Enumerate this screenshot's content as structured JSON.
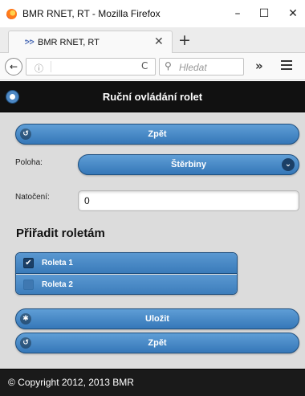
{
  "window": {
    "title": "BMR RNET, RT - Mozilla Firefox",
    "minimize": "–",
    "maximize": "☐",
    "close": "✕"
  },
  "tab": {
    "title": "BMR RNET, RT",
    "favicon": "ᕗᕗ",
    "close": "✕",
    "new_tab": "+"
  },
  "nav": {
    "back": "←",
    "info": "ⓘ",
    "reload": "C",
    "search_icon": "⚲",
    "search_placeholder": "Hledat",
    "overflow": "»"
  },
  "page": {
    "header_title": "Ruční ovládání rolet",
    "back_top_label": "Zpět",
    "poloha_label": "Poloha:",
    "poloha_value": "Štěrbiny",
    "natoceni_label": "Natočení:",
    "natoceni_value": "0",
    "section_title": "Přiřadit roletám",
    "checkboxes": [
      {
        "label": "Roleta 1",
        "checked": true
      },
      {
        "label": "Roleta 2",
        "checked": false
      }
    ],
    "save_label": "Uložit",
    "back_bottom_label": "Zpět",
    "footer": "© Copyright 2012, 2013 BMR"
  },
  "colors": {
    "button_blue": "#3a7bba",
    "header_black": "#111111"
  }
}
